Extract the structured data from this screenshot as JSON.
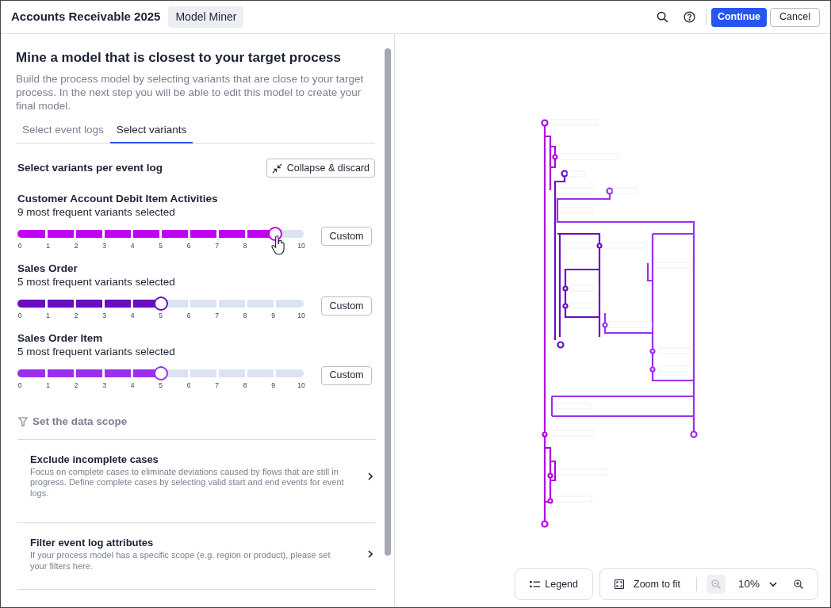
{
  "header": {
    "title": "Accounts Receivable 2025",
    "badge": "Model Miner"
  },
  "buttons": [
    {
      "label": "Continue",
      "kind": "primary"
    },
    {
      "label": "Cancel",
      "kind": "secondary"
    }
  ],
  "panel": {
    "heading": "Mine a model that is closest to your target process",
    "description": "Build the process model by selecting variants that are close to your target process. In the next step you will be able to edit this model to create your final model.",
    "tabs": [
      {
        "label": "Select event logs",
        "selected": false
      },
      {
        "label": "Select variants",
        "selected": true
      }
    ],
    "section_title": "Select variants per event log",
    "collapse_button": "Collapse & discard",
    "event_logs": [
      {
        "name": "Customer Account Debit Item Activities",
        "summary": "9 most frequent variants selected",
        "level": 0.9,
        "color": "#c000f0",
        "ticks": [
          "0",
          "1",
          "2",
          "3",
          "4",
          "5",
          "6",
          "7",
          "8",
          "10"
        ],
        "pointer": true,
        "button": "Custom"
      },
      {
        "name": "Sales Order",
        "summary": "5 most frequent variants selected",
        "level": 0.5,
        "color": "#6a0dbf",
        "ticks": [
          "0",
          "1",
          "2",
          "3",
          "4",
          "5",
          "6",
          "7",
          "8",
          "9",
          "10"
        ],
        "button": "Custom"
      },
      {
        "name": "Sales Order Item",
        "summary": "5 most frequent variants selected",
        "level": 0.5,
        "color": "#9b2ff0",
        "ticks": [
          "0",
          "1",
          "2",
          "3",
          "4",
          "5",
          "6",
          "7",
          "8",
          "9",
          "10"
        ],
        "button": "Custom"
      }
    ],
    "scope_title": "Set the data scope",
    "scope_items": [
      {
        "title": "Exclude incomplete cases",
        "description": "Focus on complete cases to eliminate deviations caused by flows that are still in progress. Define complete cases by selecting valid start and end events for event logs."
      },
      {
        "title": "Filter event log attributes",
        "description": "If your process model has a specific scope (e.g. region or product), please set your filters here."
      }
    ]
  },
  "canvas": {
    "legend_button": "Legend",
    "zoom_fit_button": "Zoom to fit",
    "zoom_level": "10%"
  }
}
